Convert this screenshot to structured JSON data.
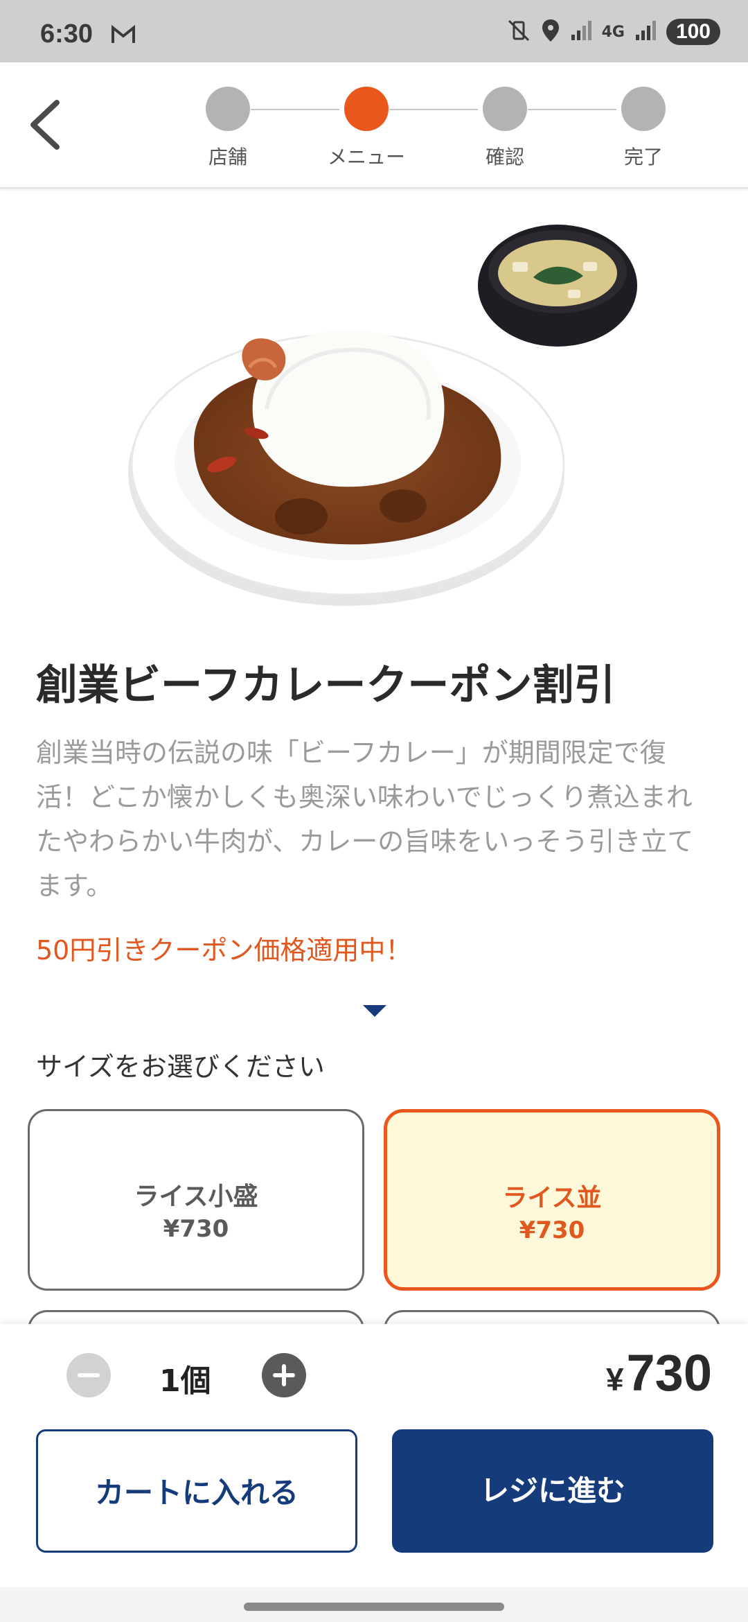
{
  "status_bar": {
    "time": "6:30",
    "network": "4G",
    "battery": "100"
  },
  "stepper": {
    "steps": [
      "店舗",
      "メニュー",
      "確認",
      "完了"
    ],
    "active_index": 1
  },
  "product": {
    "title": "創業ビーフカレークーポン割引",
    "description": "創業当時の伝説の味「ビーフカレー」が期間限定で復活！どこか懐かしくも奥深い味わいでじっくり煮込まれたやわらかい牛肉が、カレーの旨味をいっそう引き立てます。",
    "coupon_note": "50円引きクーポン価格適用中！"
  },
  "size_section": {
    "prompt": "サイズをお選びください",
    "options": [
      {
        "name": "ライス小盛",
        "price": "¥730",
        "selected": false
      },
      {
        "name": "ライス並",
        "price": "¥730",
        "selected": true
      }
    ]
  },
  "order": {
    "quantity": "1個",
    "total_currency": "¥",
    "total_amount": "730",
    "cart_label": "カートに入れる",
    "checkout_label": "レジに進む"
  },
  "colors": {
    "accent": "#e9571d",
    "primary": "#153b7a",
    "selected_bg": "#fdf8d9"
  }
}
